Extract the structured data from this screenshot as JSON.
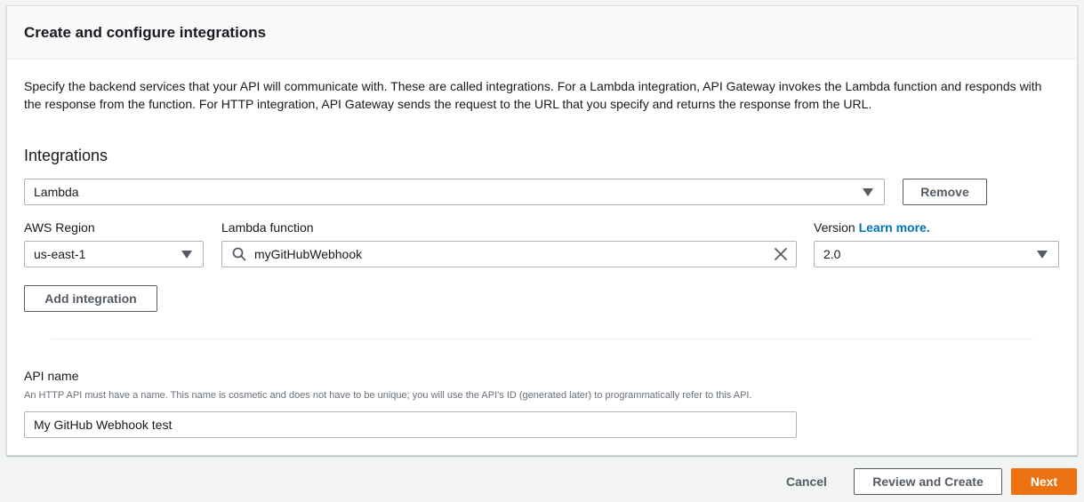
{
  "card": {
    "title": "Create and configure integrations",
    "description": "Specify the backend services that your API will communicate with. These are called integrations. For a Lambda integration, API Gateway invokes the Lambda function and responds with the response from the function. For HTTP integration, API Gateway sends the request to the URL that you specify and returns the response from the URL."
  },
  "integrations": {
    "heading": "Integrations",
    "type_value": "Lambda",
    "remove_label": "Remove",
    "region_label": "AWS Region",
    "region_value": "us-east-1",
    "function_label": "Lambda function",
    "function_value": "myGitHubWebhook",
    "version_label": "Version",
    "version_link": "Learn more.",
    "version_value": "2.0",
    "add_label": "Add integration"
  },
  "api_name": {
    "label": "API name",
    "help": "An HTTP API must have a name. This name is cosmetic and does not have to be unique; you will use the API's ID (generated later) to programmatically refer to this API.",
    "value": "My GitHub Webhook test"
  },
  "footer": {
    "cancel_label": "Cancel",
    "review_label": "Review and Create",
    "next_label": "Next"
  },
  "colors": {
    "primary": "#ec7211",
    "link": "#0073bb",
    "border": "#aab7b8",
    "text": "#16191f"
  },
  "icons": {
    "search": "search-icon",
    "clear": "close-icon",
    "caret": "caret-down-icon"
  }
}
